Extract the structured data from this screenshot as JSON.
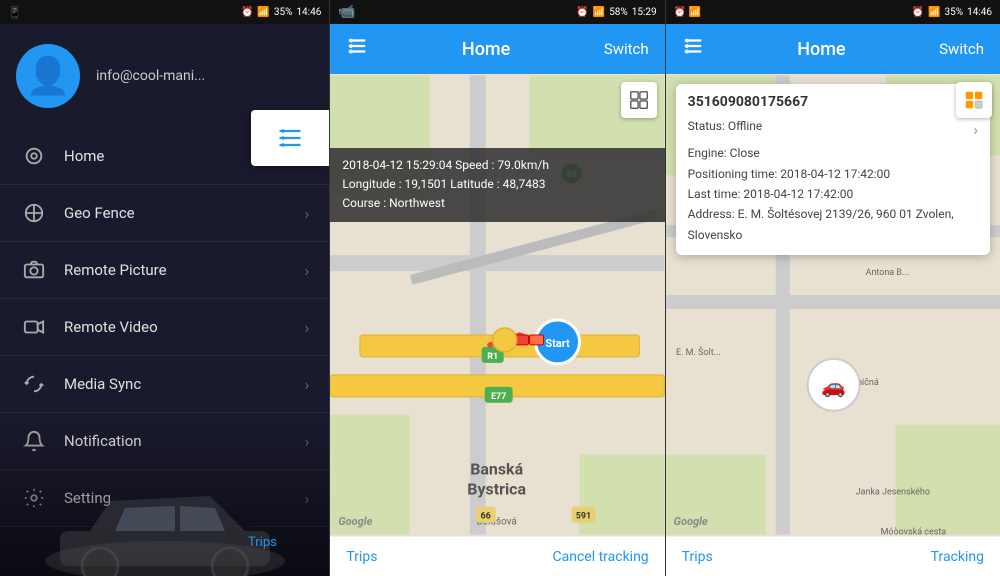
{
  "panel1": {
    "statusBar": {
      "left": "📱",
      "time": "14:46",
      "battery": "35%",
      "alarm": "⏰",
      "wifi": "WiFi",
      "signal": "📶"
    },
    "profile": {
      "email": "info@cool-mani..."
    },
    "menu": [
      {
        "id": "home",
        "label": "Home",
        "icon": "📍"
      },
      {
        "id": "geo-fence",
        "label": "Geo Fence",
        "icon": "⚙️"
      },
      {
        "id": "remote-picture",
        "label": "Remote Picture",
        "icon": "📷"
      },
      {
        "id": "remote-video",
        "label": "Remote Video",
        "icon": "🎬"
      },
      {
        "id": "media-sync",
        "label": "Media Sync",
        "icon": "🔄"
      },
      {
        "id": "notification",
        "label": "Notification",
        "icon": "🔔"
      },
      {
        "id": "setting",
        "label": "Setting",
        "icon": "ℹ️"
      }
    ],
    "trips": "Trips"
  },
  "panel2": {
    "statusBar": {
      "alarm": "⏰",
      "wifi": "WiFi",
      "battery": "58%",
      "time": "15:29"
    },
    "header": {
      "title": "Home",
      "switch": "Switch"
    },
    "infoOverlay": {
      "line1": "2018-04-12 15:29:04  Speed : 79.0km/h",
      "line2": "Longitude : 19,1501  Latitude : 48,7483",
      "line3": "Course : Northwest"
    },
    "startMarker": "Start",
    "googleLogo": "Google",
    "footer": {
      "trips": "Trips",
      "cancelTracking": "Cancel tracking"
    }
  },
  "panel3": {
    "statusBar": {
      "alarm": "⏰",
      "wifi": "WiFi",
      "battery": "35%",
      "time": "14:46"
    },
    "header": {
      "title": "Home",
      "switch": "Switch"
    },
    "infoCard": {
      "deviceId": "351609080175667",
      "status": "Status:  Offline",
      "engine": "Engine:  Close",
      "positioningTime": "Positioning time:  2018-04-12 17:42:00",
      "lastTime": "Last time:  2018-04-12 17:42:00",
      "address": "Address:  E. M. Šoltésovej 2139/26, 960 01 Zvolen, Slovensko"
    },
    "googleLogo": "Google",
    "footer": {
      "trips": "Trips",
      "tracking": "Tracking"
    }
  }
}
